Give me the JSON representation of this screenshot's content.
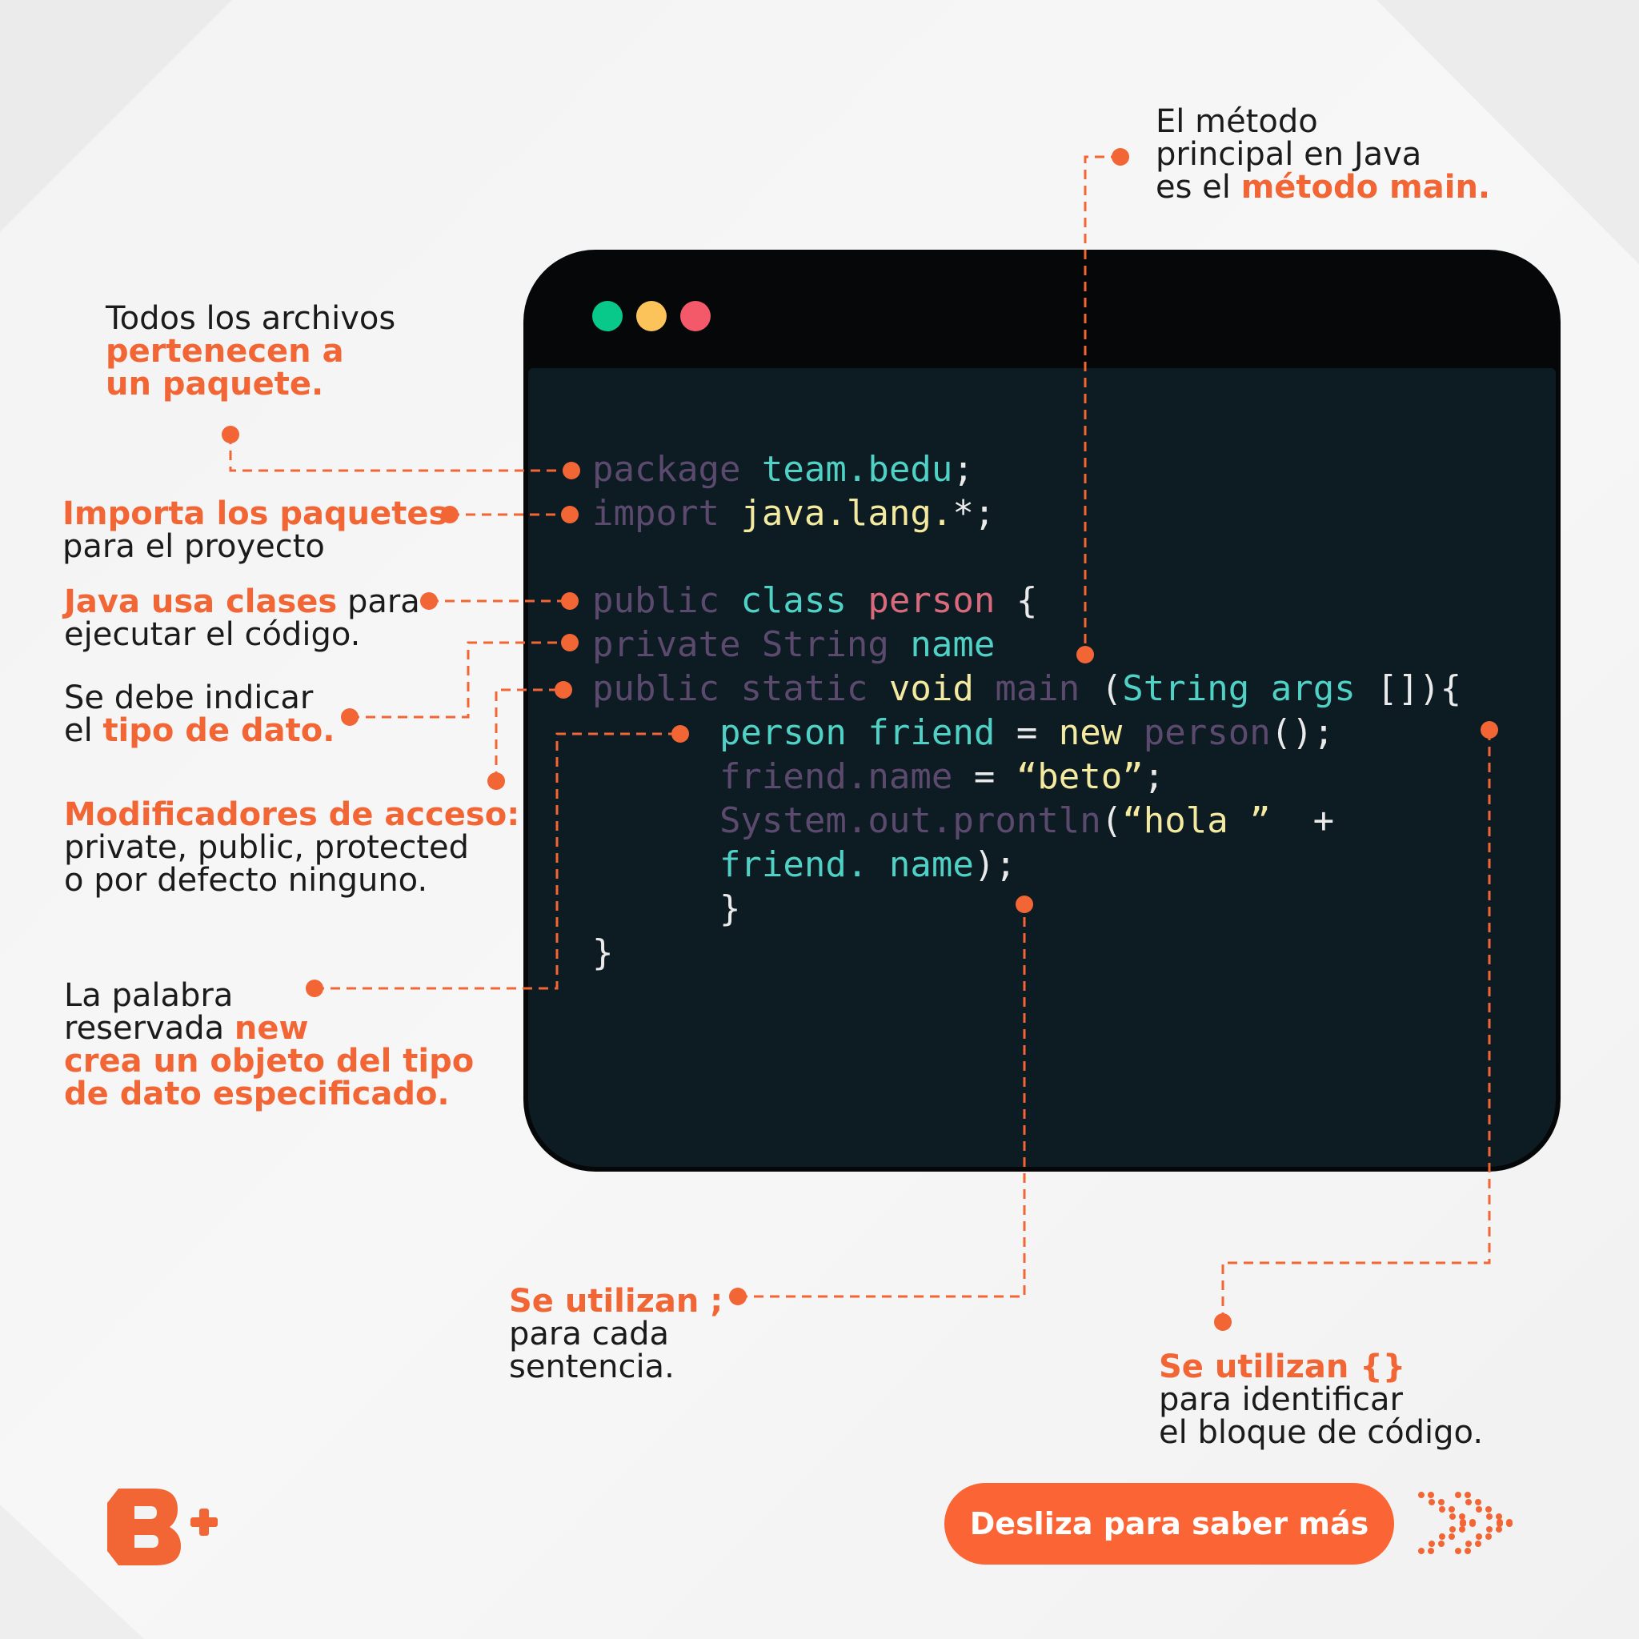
{
  "window": {
    "traffic_lights": {
      "green": "#08c88a",
      "yellow": "#fbc35a",
      "red": "#f4596a"
    }
  },
  "code": [
    [
      {
        "t": "package ",
        "c": "kw"
      },
      {
        "t": "team.bedu",
        "c": "teal"
      },
      {
        "t": ";",
        "c": "white"
      }
    ],
    [
      {
        "t": "import ",
        "c": "kw"
      },
      {
        "t": "java.lang.",
        "c": "yellow"
      },
      {
        "t": "*",
        "c": "white"
      },
      {
        "t": ";",
        "c": "white"
      }
    ],
    [],
    [
      {
        "t": "public ",
        "c": "kw"
      },
      {
        "t": "class ",
        "c": "teal"
      },
      {
        "t": "person ",
        "c": "pink"
      },
      {
        "t": "{",
        "c": "white"
      }
    ],
    [
      {
        "t": "private ",
        "c": "kw"
      },
      {
        "t": "String ",
        "c": "kw"
      },
      {
        "t": "name",
        "c": "teal"
      }
    ],
    [
      {
        "t": "public ",
        "c": "kw"
      },
      {
        "t": "static ",
        "c": "kw"
      },
      {
        "t": "void ",
        "c": "yellow"
      },
      {
        "t": "main ",
        "c": "kw"
      },
      {
        "t": "(",
        "c": "white"
      },
      {
        "t": "String ",
        "c": "teal"
      },
      {
        "t": "args ",
        "c": "teal"
      },
      {
        "t": "[]){",
        "c": "white"
      }
    ],
    [
      {
        "t": "      person ",
        "c": "teal"
      },
      {
        "t": "friend ",
        "c": "teal"
      },
      {
        "t": "= ",
        "c": "white"
      },
      {
        "t": "new ",
        "c": "yellow"
      },
      {
        "t": "person",
        "c": "kw"
      },
      {
        "t": "();",
        "c": "white"
      }
    ],
    [
      {
        "t": "      friend.name ",
        "c": "kw"
      },
      {
        "t": "= ",
        "c": "white"
      },
      {
        "t": "“beto”",
        "c": "yellow"
      },
      {
        "t": ";",
        "c": "white"
      }
    ],
    [
      {
        "t": "      System.out.prontln",
        "c": "kw"
      },
      {
        "t": "(",
        "c": "white"
      },
      {
        "t": "“hola ”",
        "c": "yellow"
      },
      {
        "t": "  +",
        "c": "white"
      }
    ],
    [
      {
        "t": "      friend. ",
        "c": "teal"
      },
      {
        "t": "name",
        "c": "teal"
      },
      {
        "t": ");",
        "c": "white"
      }
    ],
    [
      {
        "t": "      }",
        "c": "white"
      }
    ],
    [
      {
        "t": "}",
        "c": "white"
      }
    ]
  ],
  "callouts": {
    "metodo_main": {
      "l1": "El método",
      "l2": "principal en Java",
      "l3a": "es el ",
      "l3b": "método main."
    },
    "paquete": {
      "l1": "Todos los archivos",
      "l2": "pertenecen a",
      "l3": "un paquete."
    },
    "importa": {
      "l1": "Importa los paquetes",
      "l2": "para el proyecto"
    },
    "clases": {
      "l1a": "Java usa clases",
      "l1b": " para",
      "l2": "ejecutar el código."
    },
    "tipo": {
      "l1": "Se debe indicar",
      "l2a": "el ",
      "l2b": "tipo de dato."
    },
    "modificadores": {
      "l1": "Modificadores de acceso:",
      "l2": "private, public, protected",
      "l3": "o por defecto ninguno."
    },
    "new": {
      "l1": "La palabra",
      "l2a": "reservada ",
      "l2b": "new",
      "l3": "crea un objeto del tipo",
      "l4": "de dato especificado."
    },
    "punto_coma": {
      "l1": "Se utilizan ;",
      "l2": "para cada",
      "l3": "sentencia."
    },
    "llaves": {
      "l1": "Se utilizan {}",
      "l2": "para identificar",
      "l3": "el bloque de código."
    }
  },
  "cta": {
    "label": "Desliza para saber más"
  },
  "colors": {
    "accent": "#f26535",
    "code_bg": "#0d1b23",
    "window_frame": "#050708"
  },
  "icons": {
    "logo": "bedu-logo-icon",
    "arrows": "dotted-double-chevron-icon"
  }
}
